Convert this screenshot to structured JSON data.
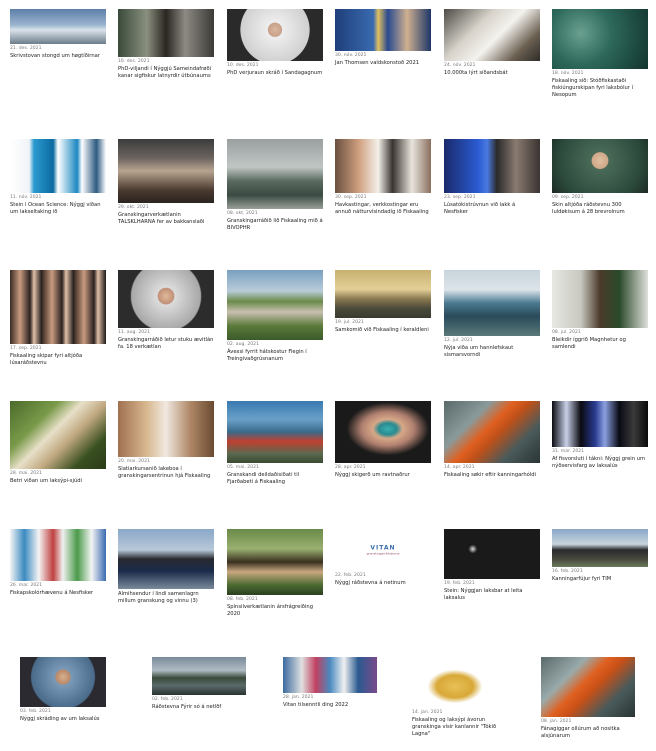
{
  "articles": [
    {
      "date": "21. des. 2021",
      "title": "Skrivstovan stongd um høgtíðirnar"
    },
    {
      "date": "16. des. 2021",
      "title": "PhD-viljandi í Nýggjú Sameindafrøði kanar sigfiskur latnyrdir útbúnaums"
    },
    {
      "date": "10. des. 2021",
      "title": "PhD verjuraun skráð í Sandagagnum"
    },
    {
      "date": "30. nóv. 2021",
      "title": "Jan Thomsen valdskonstoð 2021"
    },
    {
      "date": "24. nóv. 2021",
      "title": "10.000ta lýrt síðandsbát"
    },
    {
      "date": "18. nóv. 2021",
      "title": "Fiskaaling sið: Stóðfiskastaði fiskiúngurskipan fyri laksbólur í Nesopum"
    },
    {
      "date": "11. nóv. 2021",
      "title": "Stein í Ocean Science: Nýggj viðan um lakseltaking ið"
    },
    {
      "date": "29. okt. 2021",
      "title": "Granskingarverkætlanin TALSKLHARNA fer av bakkanslaði"
    },
    {
      "date": "08. okt. 2021",
      "title": "Granskingarráðið lið Fiskaaling mið á BIVOPHR"
    },
    {
      "date": "30. sep. 2021",
      "title": "Havkastingar, verkkostingar eru annuð nátturvísindadíg ið Fiskaaling"
    },
    {
      "date": "23. sep. 2021",
      "title": "Lúsatókistrúvnun við lakk á Nesfisker"
    },
    {
      "date": "09. sep. 2021",
      "title": "Skin altjóða ráðstevnu 300 luldøkisum á 28 brevrolnum"
    },
    {
      "date": "17. sep. 2021",
      "title": "Fiskaaling skipar fyri altjóða lúsaráðstevnu"
    },
    {
      "date": "11. aug. 2021",
      "title": "Granskingarráðið letur stuku ævitlán fa. 18 verkætlan"
    },
    {
      "date": "02. aug. 2021",
      "title": "Ávexsi fyrrit hátskostur Fiegin í Treingivaðgrúsnanum"
    },
    {
      "date": "19. jul. 2021",
      "title": "Samkomið við Fiskaaling í keraldleni"
    },
    {
      "date": "12. jul. 2021",
      "title": "Nýja viða um hannlefskaut sismarsvorndi"
    },
    {
      "date": "08. jul. 2021",
      "title": "Bleikdir íggrið Magnhetur og samlendi"
    },
    {
      "date": "28. mai. 2021",
      "title": "Betri viðan um laksýpi-sjúdi"
    },
    {
      "date": "20. mai. 2021",
      "title": "Slatiarkursanið lakeboa í granskingarsentrinun hjá Fiskaaling"
    },
    {
      "date": "05. mai. 2021",
      "title": "Granskandi deildaðisiðati til Fjarðabeti á Fiskaaling"
    },
    {
      "date": "28. apr. 2021",
      "title": "Nýggj skigerð um ravtnaðrur"
    },
    {
      "date": "14. apr. 2021",
      "title": "Fiskaaling søkir eftir kanningarhóldi"
    },
    {
      "date": "31. mar. 2021",
      "title": "Af fisvorsluti í tákni: Nýggj grein um nýðservisfarg av laksalús"
    },
    {
      "date": "26. mar. 2021",
      "title": "Fiskapskolórhævenu á Nesfisker"
    },
    {
      "date": "",
      "title": "Almihsendur í lindi samenlagrn millum granskung og vinnu (3)"
    },
    {
      "date": "08. feb. 2021",
      "title": "Spínsilverkætlanin ársfrágreiðing 2020"
    },
    {
      "date": "22. feb. 2021",
      "title": "Nýggj ráðstevna á netinum"
    },
    {
      "date": "19. feb. 2021",
      "title": "Stein: Nýggjan laksbar at leita laksalus"
    },
    {
      "date": "16. feb. 2021",
      "title": "Kanningarfújur fyri TIM"
    },
    {
      "date": "03. feb. 2021",
      "title": "Nýggj skráding av um laksalús"
    },
    {
      "date": "02. feb. 2021",
      "title": "Ráðstevna Fýrir só á netlðf"
    },
    {
      "date": "28. jan. 2021",
      "title": "Vitan tilsenntli ding 2022"
    },
    {
      "date": "14. jan. 2021",
      "title": "Fiskaaling og laksýpi ávorun granskinga vísir kanlannir \"Tókið Lagna\""
    },
    {
      "date": "08. jan. 2021",
      "title": "Fánagiggar ollúrum að nositka alsjúnarum"
    }
  ],
  "logo_text": {
    "name": "VITAN",
    "tagline": "granskingarráðstevna"
  },
  "colors": {
    "background": "#ffffff",
    "date": "#7a7a7a",
    "title": "#222222"
  }
}
